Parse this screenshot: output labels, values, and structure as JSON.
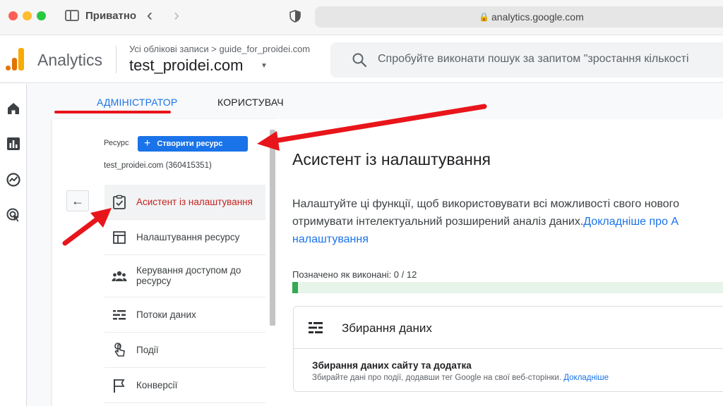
{
  "browser": {
    "private_label": "Приватно",
    "url": "analytics.google.com"
  },
  "header": {
    "product_name": "Analytics",
    "breadcrumb": "Усі облікові записи > guide_for_proidei.com",
    "property_name": "test_proidei.com",
    "search_placeholder": "Спробуйте виконати пошук за запитом \"зростання кількості"
  },
  "tabs": {
    "admin": "АДМІНІСТРАТОР",
    "user": "КОРИСТУВАЧ"
  },
  "admin": {
    "resource_label": "Ресурс",
    "create_button": "Створити ресурс",
    "property_id": "test_proidei.com (360415351)",
    "menu": [
      {
        "label": "Асистент із налаштування",
        "icon": "checklist-icon"
      },
      {
        "label": "Налаштування ресурсу",
        "icon": "layout-icon"
      },
      {
        "label": "Керування доступом до ресурсу",
        "icon": "people-icon"
      },
      {
        "label": "Потоки даних",
        "icon": "data-streams-icon"
      },
      {
        "label": "Події",
        "icon": "touch-icon"
      },
      {
        "label": "Конверсії",
        "icon": "flag-icon"
      }
    ]
  },
  "main": {
    "title": "Асистент із налаштування",
    "desc_line1": "Налаштуйте ці функції, щоб використовувати всі можливості свого нового ",
    "desc_line2": "отримувати інтелектуальний розширений аналіз даних.",
    "desc_link1": "Докладніше про А",
    "desc_link2": "налаштування",
    "completed_label": "Позначено як виконані: 0 / 12",
    "progress_fraction": 0.012,
    "card": {
      "title": "Збирання даних",
      "sub_title": "Збирання даних сайту та додатка",
      "sub_desc": "Збирайте дані про події, додавши тег Google на свої веб-сторінки. ",
      "sub_link": "Докладніше"
    }
  },
  "colors": {
    "accent": "#1a73e8",
    "annotation": "#e8151b",
    "active_text": "#c5221f",
    "progress": "#34a853"
  }
}
